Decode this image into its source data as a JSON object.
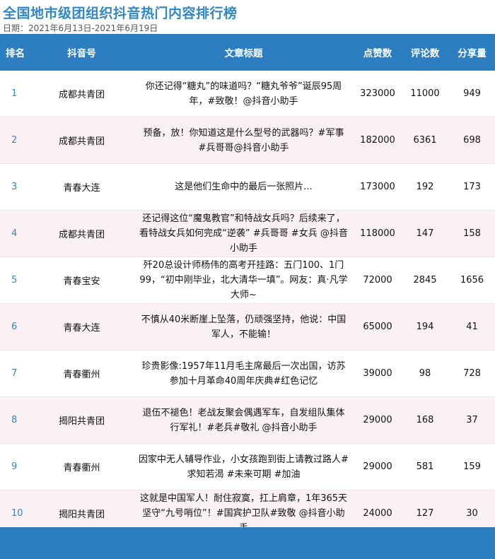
{
  "title": "全国地市级团组织抖音热门内容排行榜",
  "date": "日期：2021年6月13日-2021年6月19日",
  "columns": [
    "排名",
    "抖音号",
    "文章标题",
    "点赞数",
    "评论数",
    "分享量"
  ],
  "rows": [
    {
      "rank": "1",
      "account": "成都共青团",
      "text": "你还记得“糖丸”的味道吗？“糖丸爷爷”诞辰95周年，#致敬！@抖音小助手",
      "likes": "323000",
      "comments": "11000",
      "shares": "949"
    },
    {
      "rank": "2",
      "account": "成都共青团",
      "text": "预备，放！你知道这是什么型号的武器吗？#军事 #兵哥哥@抖音小助手",
      "likes": "182000",
      "comments": "6361",
      "shares": "698"
    },
    {
      "rank": "3",
      "account": "青春大连",
      "text": "这是他们生命中的最后一张照片...",
      "likes": "173000",
      "comments": "192",
      "shares": "173"
    },
    {
      "rank": "4",
      "account": "成都共青团",
      "text": "还记得这位“魔鬼教官”和特战女兵吗？后续来了，看特战女兵如何完成“逆袭” #兵哥哥 #女兵 @抖音小助手",
      "likes": "118000",
      "comments": "147",
      "shares": "158"
    },
    {
      "rank": "5",
      "account": "青春宝安",
      "text": "歼20总设计师杨伟的高考开挂路：五门100、1门99，“初中刚毕业，北大清华一填”。网友：真·凡学大师~",
      "likes": "72000",
      "comments": "2845",
      "shares": "1656"
    },
    {
      "rank": "6",
      "account": "青春大连",
      "text": "不慎从40米断崖上坠落，仍顽强坚持，他说：中国军人，不能输！",
      "likes": "65000",
      "comments": "194",
      "shares": "41"
    },
    {
      "rank": "7",
      "account": "青春衢州",
      "text": "珍贵影像:1957年11月毛主席最后一次出国，访苏参加十月革命40周年庆典#红色记忆",
      "likes": "39000",
      "comments": "98",
      "shares": "728"
    },
    {
      "rank": "8",
      "account": "揭阳共青团",
      "text": "退伍不褪色！老战友聚会偶遇军车，自发组队集体行军礼！#老兵#敬礼 @抖音小助手",
      "likes": "29000",
      "comments": "168",
      "shares": "37"
    },
    {
      "rank": "9",
      "account": "青春衢州",
      "text": "因家中无人辅导作业，小女孩跑到街上请教过路人#求知若渴 #未来可期 #加油",
      "likes": "29000",
      "comments": "581",
      "shares": "159"
    },
    {
      "rank": "10",
      "account": "揭阳共青团",
      "text": "这就是中国军人！耐住寂寞，扛上肩章，1年365天坚守“九号哨位”！#国宾护卫队#致敬 @抖音小助手",
      "likes": "24000",
      "comments": "127",
      "shares": "30"
    }
  ]
}
